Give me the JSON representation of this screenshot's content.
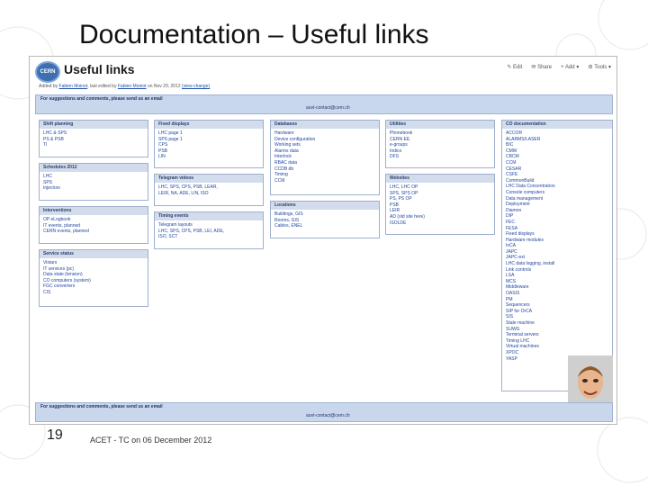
{
  "slide": {
    "title": "Documentation – Useful links",
    "page_number": "19",
    "footer": "ACET - TC on 06 December 2012"
  },
  "page": {
    "logo_text": "CERN",
    "title": "Useful links",
    "edited_prefix": "Added by",
    "edited_by": "Fabien Moinot",
    "edited_mid": ", last edited by",
    "last_editor": "Fabien Moinot",
    "edited_date": "on Nov 29, 2012",
    "view_change": "(view change)",
    "actions": {
      "edit": "Edit",
      "share": "Share",
      "add": "Add",
      "tools": "Tools"
    }
  },
  "suggestion_bar": {
    "text": "For suggestions and comments, please send us an email",
    "email": "acet-contact@cern.ch"
  },
  "sections": {
    "shift": {
      "title": "Shift planning",
      "items": [
        "LHC & SPS",
        "PS & PSB",
        "TI"
      ]
    },
    "schedules": {
      "title": "Schedules 2012",
      "items": [
        "LHC",
        "SPS",
        "Injectors"
      ]
    },
    "interventions": {
      "title": "Interventions",
      "items": [
        "OP eLogbook",
        "IT events, planned",
        "CERN events, planned"
      ]
    },
    "service": {
      "title": "Service status",
      "items": [
        "Vistars",
        "IT services (pc)",
        "Data state (tension)",
        "CO computers (system)",
        "FGC converters",
        "CIS"
      ]
    },
    "fixed": {
      "title": "Fixed displays",
      "items": [
        "LHC page 1",
        "SPS page 1",
        "CPS",
        "PSB",
        "LIN"
      ]
    },
    "telegram": {
      "title": "Telegram videos",
      "items": [
        "LHC, SPS, CPS, PSB, LEAR,",
        "LEIR, NA, ADE, LIN, ISO"
      ]
    },
    "timing": {
      "title": "Timing events",
      "items": [
        "Telegram layouts",
        "LHC, SPS, CPS, PSB, LEI, ADE,",
        "ISO, SCT"
      ]
    },
    "databases": {
      "title": "Databases",
      "items": [
        "Hardware",
        "Device configuration",
        "Working sets",
        "Alarms data",
        "Interlock",
        "RBAC data",
        "CCDB db",
        "Timing",
        "CCM"
      ]
    },
    "locations": {
      "title": "Locations",
      "items": [
        "Buildings, GIS",
        "Rooms, GIS",
        "Cables, ENEL"
      ]
    },
    "utilities": {
      "title": "Utilities",
      "items": [
        "Phonebook",
        "CERN EE",
        "e-groups",
        "Indico",
        "DFS"
      ]
    },
    "websites": {
      "title": "Websites",
      "items": [
        "LHC, LHC OP",
        "SPS, SPS OP",
        "PS, PS OP",
        "PSB",
        "LEIR",
        "AD (old site here)",
        "ISOLDE"
      ]
    },
    "co": {
      "title": "CO documentation",
      "items": [
        "ACCOR",
        "ALARMS/LASER",
        "BIC",
        "CMW",
        "CBCM",
        "CCM",
        "CESAR",
        "CSFE",
        "CommonBuild",
        "LHC Data Concentrators",
        "Console computers",
        "Data management",
        "Deployment",
        "Diamon",
        "DIP",
        "FEC",
        "FESA",
        "Fixed displays",
        "Hardware modules",
        "InCA",
        "JAPC",
        "JAPC-ext",
        "LHC data logging, install",
        "Link controls",
        "LSA",
        "MCS",
        "Middleware",
        "OASIS",
        "PM",
        "Sequencers",
        "SIP for OrCA",
        "SIS",
        "State machine",
        "SUWG",
        "Terminal servers",
        "Timing LHC",
        "Virtual machines",
        "XPOC",
        "YASP"
      ]
    }
  }
}
